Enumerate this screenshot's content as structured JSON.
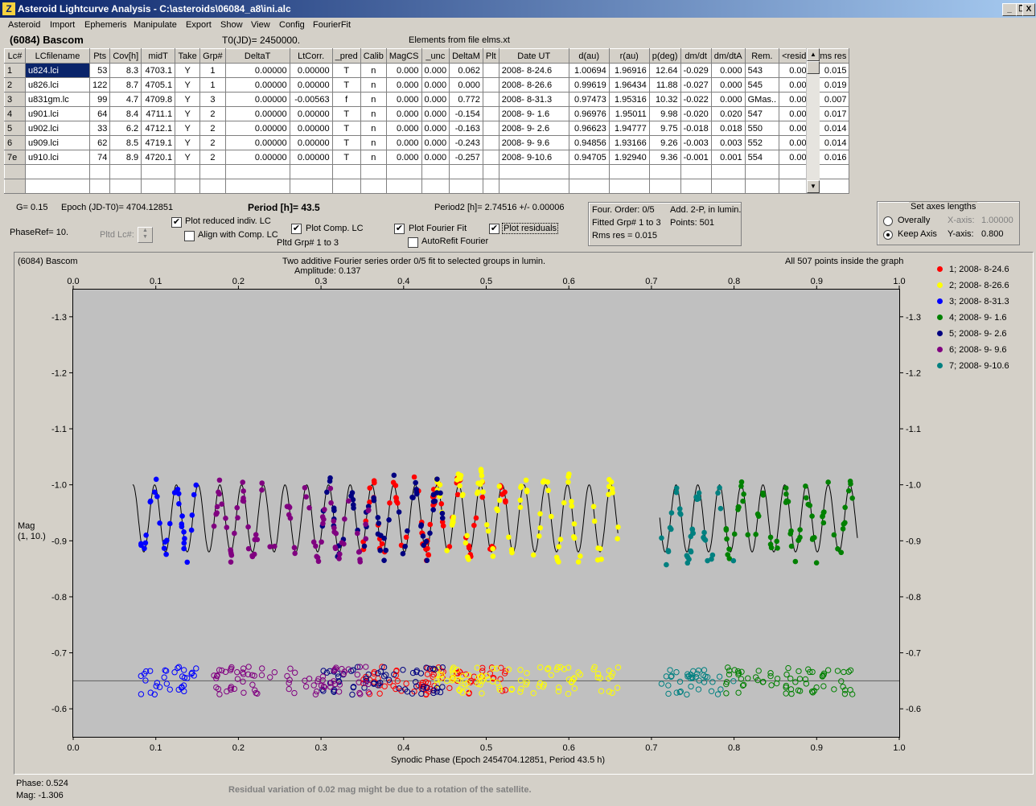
{
  "window": {
    "title": "Asteroid Lightcurve Analysis - C:\\asteroids\\06084_a8\\ini.alc",
    "app_icon": "Z",
    "buttons": {
      "minimize": "_",
      "restore": "❐",
      "close": "X"
    }
  },
  "menu": [
    "Asteroid",
    "Import",
    "Ephemeris",
    "Manipulate",
    "Export",
    "Show",
    "View",
    "Config",
    "FourierFit"
  ],
  "header": {
    "asteroid": "(6084) Bascom",
    "t0": "T0(JD)= 2450000.",
    "elements": "Elements from file elms.xt"
  },
  "table": {
    "columns": [
      "Lc#",
      "LCfilename",
      "Pts",
      "Cov[h]",
      "midT",
      "Take",
      "Grp#",
      "DeltaT",
      "LtCorr.",
      "_pred",
      "Calib",
      "MagCS",
      "_unc",
      "DeltaM",
      "Plt",
      "Date UT",
      "d(au)",
      "r(au)",
      "p(deg)",
      "dm/dt",
      "dm/dtA",
      "Rem.",
      "<resid>",
      "rms res"
    ],
    "rows": [
      [
        "1",
        "u824.lci",
        "53",
        "8.3",
        "4703.1",
        "Y",
        "1",
        "0.00000",
        "0.00000",
        "T",
        "n",
        "0.000",
        "0.000",
        "0.062",
        "",
        "2008- 8-24.6",
        "1.00694",
        "1.96916",
        "12.64",
        "-0.029",
        "0.000",
        "543",
        "0.000",
        "0.015"
      ],
      [
        "2",
        "u826.lci",
        "122",
        "8.7",
        "4705.1",
        "Y",
        "1",
        "0.00000",
        "0.00000",
        "T",
        "n",
        "0.000",
        "0.000",
        "0.000",
        "",
        "2008- 8-26.6",
        "0.99619",
        "1.96434",
        "11.88",
        "-0.027",
        "0.000",
        "545",
        "0.000",
        "0.019"
      ],
      [
        "3",
        "u831gm.lc",
        "99",
        "4.7",
        "4709.8",
        "Y",
        "3",
        "0.00000",
        "-0.00563",
        "f",
        "n",
        "0.000",
        "0.000",
        "0.772",
        "",
        "2008- 8-31.3",
        "0.97473",
        "1.95316",
        "10.32",
        "-0.022",
        "0.000",
        "GMas..",
        "0.000",
        "0.007"
      ],
      [
        "4",
        "u901.lci",
        "64",
        "8.4",
        "4711.1",
        "Y",
        "2",
        "0.00000",
        "0.00000",
        "T",
        "n",
        "0.000",
        "0.000",
        "-0.154",
        "",
        "2008- 9- 1.6",
        "0.96976",
        "1.95011",
        "9.98",
        "-0.020",
        "0.020",
        "547",
        "0.000",
        "0.017"
      ],
      [
        "5",
        "u902.lci",
        "33",
        "6.2",
        "4712.1",
        "Y",
        "2",
        "0.00000",
        "0.00000",
        "T",
        "n",
        "0.000",
        "0.000",
        "-0.163",
        "",
        "2008- 9- 2.6",
        "0.96623",
        "1.94777",
        "9.75",
        "-0.018",
        "0.018",
        "550",
        "0.000",
        "0.014"
      ],
      [
        "6",
        "u909.lci",
        "62",
        "8.5",
        "4719.1",
        "Y",
        "2",
        "0.00000",
        "0.00000",
        "T",
        "n",
        "0.000",
        "0.000",
        "-0.243",
        "",
        "2008- 9- 9.6",
        "0.94856",
        "1.93166",
        "9.26",
        "-0.003",
        "0.003",
        "552",
        "0.000",
        "0.014"
      ],
      [
        "7e",
        "u910.lci",
        "74",
        "8.9",
        "4720.1",
        "Y",
        "2",
        "0.00000",
        "0.00000",
        "T",
        "n",
        "0.000",
        "0.000",
        "-0.257",
        "",
        "2008- 9-10.6",
        "0.94705",
        "1.92940",
        "9.36",
        "-0.001",
        "0.001",
        "554",
        "0.000",
        "0.016"
      ]
    ]
  },
  "controls": {
    "g": "G= 0.15",
    "epoch": "Epoch (JD-T0)= 4704.12851",
    "period": "Period [h]= 43.5",
    "period2": "Period2 [h]= 2.74516 +/- 0.00006",
    "phaseref": "PhaseRef= 10.",
    "pltd_lc": "Pltd Lc#:",
    "plot_reduced": "Plot reduced indiv. LC",
    "align_comp": "Align with Comp. LC",
    "plot_comp": "Plot Comp. LC",
    "pltd_grp": "Pltd Grp#  1   to   3",
    "plot_fourier": "Plot Fourier Fit",
    "autorefit": "AutoRefit Fourier",
    "plot_residuals": "Plot residuals",
    "fourier_order": "Four. Order:  0/5",
    "add_2p": "Add. 2-P, in lumin.",
    "fitted_grp": "Fitted Grp# 1 to 3",
    "points": "Points: 501",
    "rms_res": "Rms res     = 0.015",
    "axes_title": "Set axes lengths",
    "overally": "Overally",
    "keep_axis": "Keep Axis",
    "x_axis_label": "X-axis:",
    "x_axis_value": "1.00000",
    "y_axis_label": "Y-axis:",
    "y_axis_value": "0.800",
    "check_symbol": "✔"
  },
  "chart_data": {
    "type": "scatter",
    "object": "(6084) Bascom",
    "title": "Two additive Fourier series order 0/5 fit to selected groups in lumin.",
    "subtitle": "Amplitude: 0.137",
    "note": "All 507 points inside the graph",
    "xlabel": "Synodic Phase (Epoch 2454704.12851, Period 43.5 h)",
    "ylabel": "Mag",
    "ylabel2": "(1, 10.)",
    "xlim": [
      0.0,
      1.0
    ],
    "ylim": [
      -1.35,
      -0.55
    ],
    "y_inverted": true,
    "x_ticks": [
      "0.0",
      "0.1",
      "0.2",
      "0.3",
      "0.4",
      "0.5",
      "0.6",
      "0.7",
      "0.8",
      "0.9",
      "1.0"
    ],
    "y_ticks": [
      -1.3,
      -1.2,
      -1.1,
      -1.0,
      -0.9,
      -0.8,
      -0.7,
      -0.6
    ],
    "y_tick_labels": [
      "-1.3",
      "-1.2",
      "-1.1",
      "-1.0",
      "-0.9",
      "-0.8",
      "-0.7",
      "-0.6"
    ],
    "residual_baseline": -0.65,
    "fit": {
      "mean": -0.94,
      "amplitude": 0.06,
      "phase_period": 0.0263
    },
    "series": [
      {
        "name": "1; 2008- 8-24.6",
        "color": "#ff0000",
        "x_range": [
          0.35,
          0.525
        ],
        "mean": -0.94,
        "amp": 0.06
      },
      {
        "name": "2; 2008- 8-26.6",
        "color": "#ffff00",
        "x_range": [
          0.44,
          0.66
        ],
        "mean": -0.94,
        "amp": 0.07
      },
      {
        "name": "3; 2008- 8-31.3",
        "color": "#0000ff",
        "x_range": [
          0.075,
          0.15
        ],
        "mean": -0.94,
        "amp": 0.06
      },
      {
        "name": "4; 2008- 9- 1.6",
        "color": "#008000",
        "x_range": [
          0.79,
          0.945
        ],
        "mean": -0.93,
        "amp": 0.06
      },
      {
        "name": "5; 2008- 9- 2.6",
        "color": "#000080",
        "x_range": [
          0.3,
          0.45
        ],
        "mean": -0.94,
        "amp": 0.06
      },
      {
        "name": "6; 2008- 9- 9.6",
        "color": "#800080",
        "x_range": [
          0.17,
          0.36
        ],
        "mean": -0.93,
        "amp": 0.06
      },
      {
        "name": "7; 2008- 9-10.6",
        "color": "#008080",
        "x_range": [
          0.71,
          0.8
        ],
        "mean": -0.92,
        "amp": 0.06
      }
    ]
  },
  "status": {
    "phase": "Phase:  0.524",
    "mag": "Mag:    -1.306",
    "message": "Residual variation of 0.02 mag might be due to a rotation of the satellite."
  }
}
